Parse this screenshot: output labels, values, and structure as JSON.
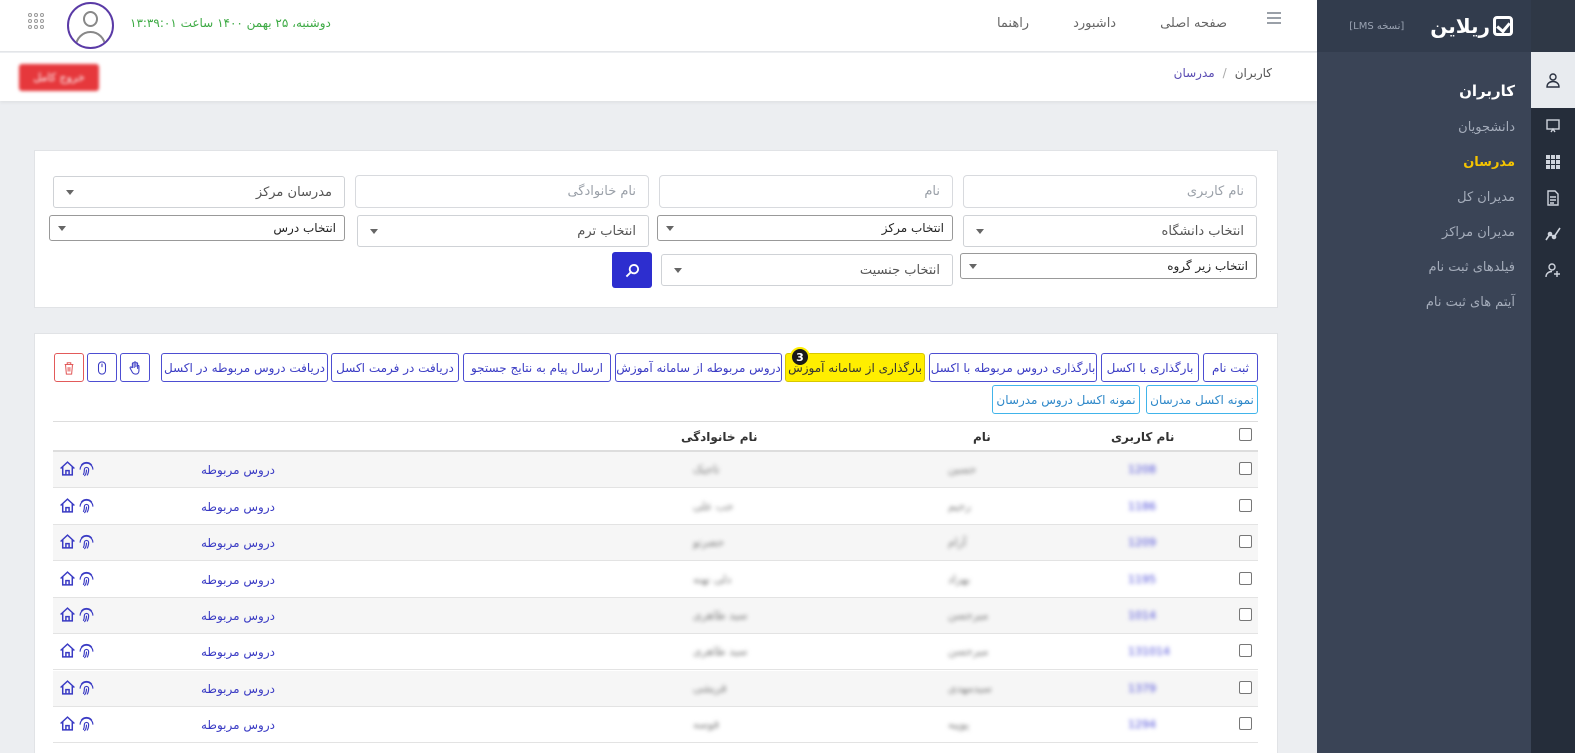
{
  "app": {
    "logo_text": "ریلاین",
    "version": "[نسخه LMS]"
  },
  "sidebar": {
    "section_title": "کاربران",
    "items": [
      {
        "label": "دانشجویان",
        "active": false
      },
      {
        "label": "مدرسان",
        "active": true
      },
      {
        "label": "مدیران کل",
        "active": false
      },
      {
        "label": "مدیران مراکز",
        "active": false
      },
      {
        "label": "فیلدهای ثبت نام",
        "active": false
      },
      {
        "label": "آیتم های ثبت نام",
        "active": false
      }
    ],
    "rail_icons": [
      "users-icon",
      "presentation-icon",
      "grid-icon",
      "document-icon",
      "chart-icon",
      "add-user-icon"
    ]
  },
  "topbar": {
    "nav": [
      "صفحه اصلی",
      "داشبورد",
      "راهنما"
    ],
    "datetime": "دوشنبه، ۲۵ بهمن ۱۴۰۰ ساعت ۱۳:۳۹:۰۱"
  },
  "breadcrumb": {
    "root": "کاربران",
    "separator": "/",
    "current": "مدرسان"
  },
  "header": {
    "exit_label": "خروج کامل"
  },
  "search": {
    "username_placeholder": "نام کاربری",
    "firstname_placeholder": "نام",
    "lastname_placeholder": "نام خانوادگی",
    "center_teachers": "مدرسان مرکز",
    "university": "انتخاب دانشگاه",
    "center": "انتخاب مرکز",
    "term": "انتخاب ترم",
    "course": "انتخاب درس",
    "subgroup": "انتخاب زیر گروه",
    "gender": "انتخاب جنسیت"
  },
  "actions": {
    "register": "ثبت نام",
    "upload_excel": "بارگذاری با اکسل",
    "upload_courses_excel": "بارگذاری دروس مربوطه با اکسل",
    "upload_from_system": "بارگذاری از سامانه آموزش",
    "courses_from_system": "دروس مربوطه از سامانه آموزش",
    "send_message": "ارسال پیام به نتایج جستجو",
    "export_excel": "دریافت در فرمت اکسل",
    "export_courses_excel": "دریافت دروس مربوطه در اکسل",
    "sample_teachers_excel": "نمونه اکسل مدرسان",
    "sample_courses_excel": "نمونه اکسل دروس مدرسان",
    "step_badge": "3",
    "highlight_color": "#ffee00"
  },
  "table": {
    "headers": {
      "username": "نام کاربری",
      "firstname": "نام",
      "lastname": "نام خانوادگی"
    },
    "related_label": "دروس مربوطه",
    "rows": [
      {
        "username": "1208",
        "firstname": "حسین",
        "lastname": "تاجیک"
      },
      {
        "username": "1186",
        "firstname": "رحیم",
        "lastname": "حب علی"
      },
      {
        "username": "1209",
        "firstname": "آزام",
        "lastname": "حضرتو"
      },
      {
        "username": "1195",
        "firstname": "بهزاد",
        "lastname": "دلی نهنه"
      },
      {
        "username": "1014",
        "firstname": "میرحسن",
        "lastname": "سید طاهری"
      },
      {
        "username": "131014",
        "firstname": "میرحسن",
        "lastname": "سید طاهری"
      },
      {
        "username": "1379",
        "firstname": "سیدمهدی",
        "lastname": "قریشی"
      },
      {
        "username": "1294",
        "firstname": "پوپیه",
        "lastname": "قوسه"
      }
    ]
  }
}
